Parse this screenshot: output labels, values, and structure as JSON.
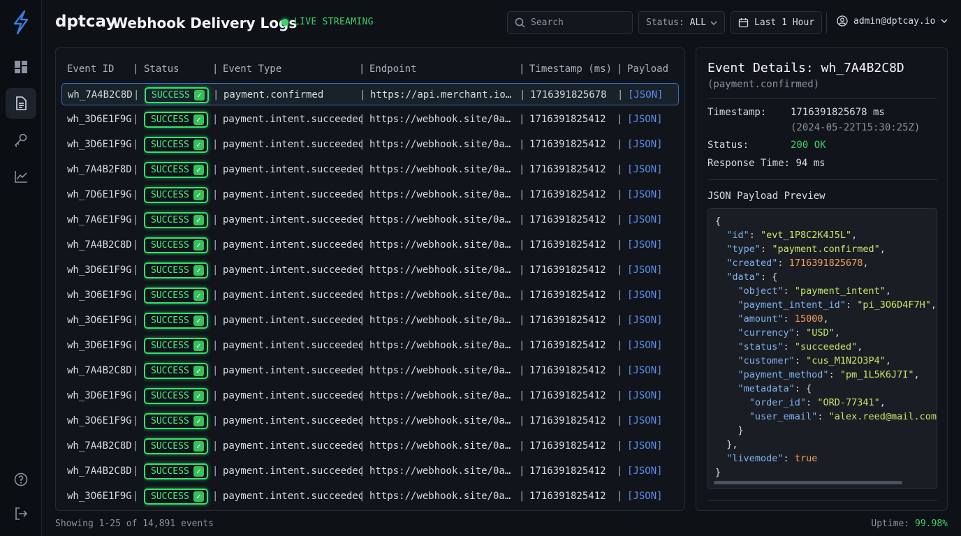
{
  "brand": "dptcay",
  "page_title": "Webhook Delivery Logs",
  "live_label": "LIVE STREAMING",
  "search": {
    "placeholder": "Search"
  },
  "status_filter": {
    "label": "Status:",
    "value": "ALL"
  },
  "time_filter": {
    "value": "Last 1 Hour"
  },
  "user": {
    "email": "admin@dptcay.io"
  },
  "colors": {
    "success": "#2ee56a",
    "accent": "#3a6fbf",
    "link": "#5b8de8",
    "background": "#0e1116"
  },
  "sidebar": {
    "items": [
      {
        "name": "dashboard-icon",
        "active": false
      },
      {
        "name": "logs-icon",
        "active": true
      },
      {
        "name": "key-icon",
        "active": false
      },
      {
        "name": "analytics-icon",
        "active": false
      },
      {
        "name": "help-icon",
        "active": false
      },
      {
        "name": "logout-icon",
        "active": false
      }
    ]
  },
  "table": {
    "columns": [
      "Event ID",
      "Status",
      "Event Type",
      "Endpoint",
      "Timestamp (ms)",
      "Payload"
    ],
    "rows": [
      {
        "id": "wh_7A4B2C8D",
        "status": "SUCCESS",
        "type": "payment.confirmed",
        "endpoint": "https://api.merchant.io/v…",
        "ts": "1716391825678",
        "payload": "[JSON]",
        "selected": true
      },
      {
        "id": "wh_3D6E1F9G",
        "status": "SUCCESS",
        "type": "payment.intent.succeeded",
        "endpoint": "https://webhook.site/0a2b…",
        "ts": "1716391825412",
        "payload": "[JSON]"
      },
      {
        "id": "wh_3D6E1F9G",
        "status": "SUCCESS",
        "type": "payment.intent.succeeded",
        "endpoint": "https://webhook.site/0a2b…",
        "ts": "1716391825412",
        "payload": "[JSON]"
      },
      {
        "id": "wh_7A4B2F8D",
        "status": "SUCCESS",
        "type": "payment.intent.succeeded",
        "endpoint": "https://webhook.site/0a2b…",
        "ts": "1716391825412",
        "payload": "[JSON]"
      },
      {
        "id": "wh_7D6E1F9G",
        "status": "SUCCESS",
        "type": "payment.intent.succeeded",
        "endpoint": "https://webhook.site/0a2b…",
        "ts": "1716391825412",
        "payload": "[JSON]"
      },
      {
        "id": "wh_7A6E1F9G",
        "status": "SUCCESS",
        "type": "payment.intent.succeeded",
        "endpoint": "https://webhook.site/0a2b…",
        "ts": "1716391825412",
        "payload": "[JSON]"
      },
      {
        "id": "wh_7A4B2C8D",
        "status": "SUCCESS",
        "type": "payment.intent.succeeded",
        "endpoint": "https://webhook.site/0a2b…",
        "ts": "1716391825412",
        "payload": "[JSON]"
      },
      {
        "id": "wh_3D6E1F9G",
        "status": "SUCCESS",
        "type": "payment.intent.succeeded",
        "endpoint": "https://webhook.site/0a2b…",
        "ts": "1716391825412",
        "payload": "[JSON]"
      },
      {
        "id": "wh_3O6E1F9G",
        "status": "SUCCESS",
        "type": "payment.intent.succeeded",
        "endpoint": "https://webhook.site/0a2b…",
        "ts": "1716391825412",
        "payload": "[JSON]"
      },
      {
        "id": "wh_3O6E1F9G",
        "status": "SUCCESS",
        "type": "payment.intent.succeeded",
        "endpoint": "https://webhook.site/0a2b…",
        "ts": "1716391825412",
        "payload": "[JSON]"
      },
      {
        "id": "wh_3D6E1F9G",
        "status": "SUCCESS",
        "type": "payment.intent.succeeded",
        "endpoint": "https://webhook.site/0a2b…",
        "ts": "1716391825412",
        "payload": "[JSON]"
      },
      {
        "id": "wh_7A4B2C8D",
        "status": "SUCCESS",
        "type": "payment.intent.succeeded",
        "endpoint": "https://webhook.site/0a2b…",
        "ts": "1716391825412",
        "payload": "[JSON]"
      },
      {
        "id": "wh_3D6E1F9G",
        "status": "SUCCESS",
        "type": "payment.intent.succeeded",
        "endpoint": "https://webhook.site/0a2b…",
        "ts": "1716391825412",
        "payload": "[JSON]"
      },
      {
        "id": "wh_3O6E1F9G",
        "status": "SUCCESS",
        "type": "payment.intent.succeeded",
        "endpoint": "https://webhook.site/0a2b…",
        "ts": "1716391825412",
        "payload": "[JSON]"
      },
      {
        "id": "wh_7A4B2C8D",
        "status": "SUCCESS",
        "type": "payment.intent.succeeded",
        "endpoint": "https://webhook.site/0a2b…",
        "ts": "1716391825412",
        "payload": "[JSON]"
      },
      {
        "id": "wh_7A4B2C8D",
        "status": "SUCCESS",
        "type": "payment.intent.succeeded",
        "endpoint": "https://webhook.site/0a2b…",
        "ts": "1716391825412",
        "payload": "[JSON]"
      },
      {
        "id": "wh_3O6E1F9G",
        "status": "SUCCESS",
        "type": "payment.intent.succeeded",
        "endpoint": "https://webhook.site/0a2b…",
        "ts": "1716391825412",
        "payload": "[JSON]"
      }
    ]
  },
  "details": {
    "title": "Event Details: wh_7A4B2C8D",
    "subtitle": "(payment.confirmed)",
    "timestamp_label": "Timestamp:",
    "timestamp_value": "1716391825678 ms",
    "timestamp_iso": "(2024-05-22T15:30:25Z)",
    "status_label": "Status:",
    "status_value": "200 OK",
    "response_label": "Response Time:",
    "response_value": "94 ms",
    "preview_label": "JSON Payload Preview",
    "payload_lines": [
      [
        [
          "p",
          "{"
        ]
      ],
      [
        [
          "p",
          "  "
        ],
        [
          "k",
          "\"id\""
        ],
        [
          "p",
          ": "
        ],
        [
          "s",
          "\"evt_1P8C2K4J5L\""
        ],
        [
          "p",
          ","
        ]
      ],
      [
        [
          "p",
          "  "
        ],
        [
          "k",
          "\"type\""
        ],
        [
          "p",
          ": "
        ],
        [
          "s",
          "\"payment.confirmed\""
        ],
        [
          "p",
          ","
        ]
      ],
      [
        [
          "p",
          "  "
        ],
        [
          "k",
          "\"created\""
        ],
        [
          "p",
          ": "
        ],
        [
          "n",
          "1716391825678"
        ],
        [
          "p",
          ","
        ]
      ],
      [
        [
          "p",
          "  "
        ],
        [
          "k",
          "\"data\""
        ],
        [
          "p",
          ": {"
        ]
      ],
      [
        [
          "p",
          "    "
        ],
        [
          "k",
          "\"object\""
        ],
        [
          "p",
          ": "
        ],
        [
          "s",
          "\"payment_intent\""
        ],
        [
          "p",
          ","
        ]
      ],
      [
        [
          "p",
          "    "
        ],
        [
          "k",
          "\"payment_intent_id\""
        ],
        [
          "p",
          ": "
        ],
        [
          "s",
          "\"pi_3O6D4F7H\""
        ],
        [
          "p",
          ","
        ]
      ],
      [
        [
          "p",
          "    "
        ],
        [
          "k",
          "\"amount\""
        ],
        [
          "p",
          ": "
        ],
        [
          "n",
          "15000"
        ],
        [
          "p",
          ","
        ]
      ],
      [
        [
          "p",
          "    "
        ],
        [
          "k",
          "\"currency\""
        ],
        [
          "p",
          ": "
        ],
        [
          "s",
          "\"USD\""
        ],
        [
          "p",
          ","
        ]
      ],
      [
        [
          "p",
          "    "
        ],
        [
          "k",
          "\"status\""
        ],
        [
          "p",
          ": "
        ],
        [
          "s",
          "\"succeeded\""
        ],
        [
          "p",
          ","
        ]
      ],
      [
        [
          "p",
          "    "
        ],
        [
          "k",
          "\"customer\""
        ],
        [
          "p",
          ": "
        ],
        [
          "s",
          "\"cus_M1N2O3P4\""
        ],
        [
          "p",
          ","
        ]
      ],
      [
        [
          "p",
          "    "
        ],
        [
          "k",
          "\"payment_method\""
        ],
        [
          "p",
          ": "
        ],
        [
          "s",
          "\"pm_1L5K6J7I\""
        ],
        [
          "p",
          ","
        ]
      ],
      [
        [
          "p",
          "    "
        ],
        [
          "k",
          "\"metadata\""
        ],
        [
          "p",
          ": {"
        ]
      ],
      [
        [
          "p",
          "      "
        ],
        [
          "k",
          "\"order_id\""
        ],
        [
          "p",
          ": "
        ],
        [
          "s",
          "\"ORD-77341\""
        ],
        [
          "p",
          ","
        ]
      ],
      [
        [
          "p",
          "      "
        ],
        [
          "k",
          "\"user_email\""
        ],
        [
          "p",
          ": "
        ],
        [
          "s",
          "\"alex.reed@mail.com\""
        ]
      ],
      [
        [
          "p",
          "    }"
        ]
      ],
      [
        [
          "p",
          "  },"
        ]
      ],
      [
        [
          "p",
          "  "
        ],
        [
          "k",
          "\"livemode\""
        ],
        [
          "p",
          ": "
        ],
        [
          "n",
          "true"
        ]
      ],
      [
        [
          "p",
          "}"
        ]
      ]
    ]
  },
  "footer": {
    "showing": "Showing 1-25 of 14,891 events",
    "uptime_label": "Uptime:",
    "uptime_value": "99.98%"
  }
}
